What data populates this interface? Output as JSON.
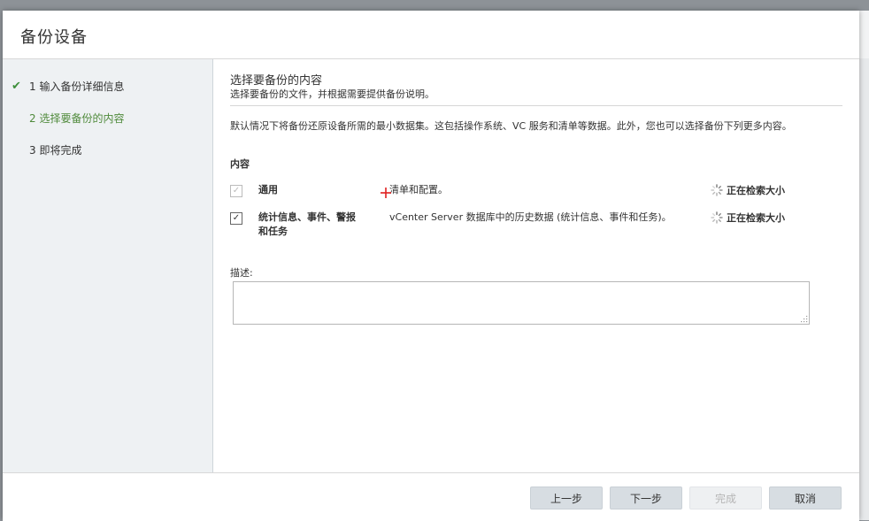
{
  "dialog": {
    "title": "备份设备"
  },
  "sidebar": {
    "steps": [
      {
        "label": "1 输入备份详细信息",
        "state": "completed",
        "icon": "checkmark-icon"
      },
      {
        "label": "2 选择要备份的内容",
        "state": "active"
      },
      {
        "label": "3 即将完成",
        "state": "pending"
      }
    ]
  },
  "main": {
    "title": "选择要备份的内容",
    "subtitle": "选择要备份的文件，并根据需要提供备份说明。",
    "description": "默认情况下将备份还原设备所需的最小数据集。这包括操作系统、VC 服务和清单等数据。此外，您也可以选择备份下列更多内容。",
    "content_label": "内容",
    "items": [
      {
        "name": "通用",
        "description": "清单和配置。",
        "status": "正在检索大小",
        "checked": true,
        "disabled": true
      },
      {
        "name": "统计信息、事件、警报和任务",
        "description": "vCenter Server 数据库中的历史数据 (统计信息、事件和任务)。",
        "status": "正在检索大小",
        "checked": true,
        "disabled": false
      }
    ],
    "notes_label": "描述:",
    "notes_value": ""
  },
  "footer": {
    "back_label": "上一步",
    "next_label": "下一步",
    "finish_label": "完成",
    "cancel_label": "取消"
  },
  "colors": {
    "accent_green": "#4f8a3b",
    "sidebar_bg": "#eef1f3",
    "button_bg": "#d7dde2"
  }
}
